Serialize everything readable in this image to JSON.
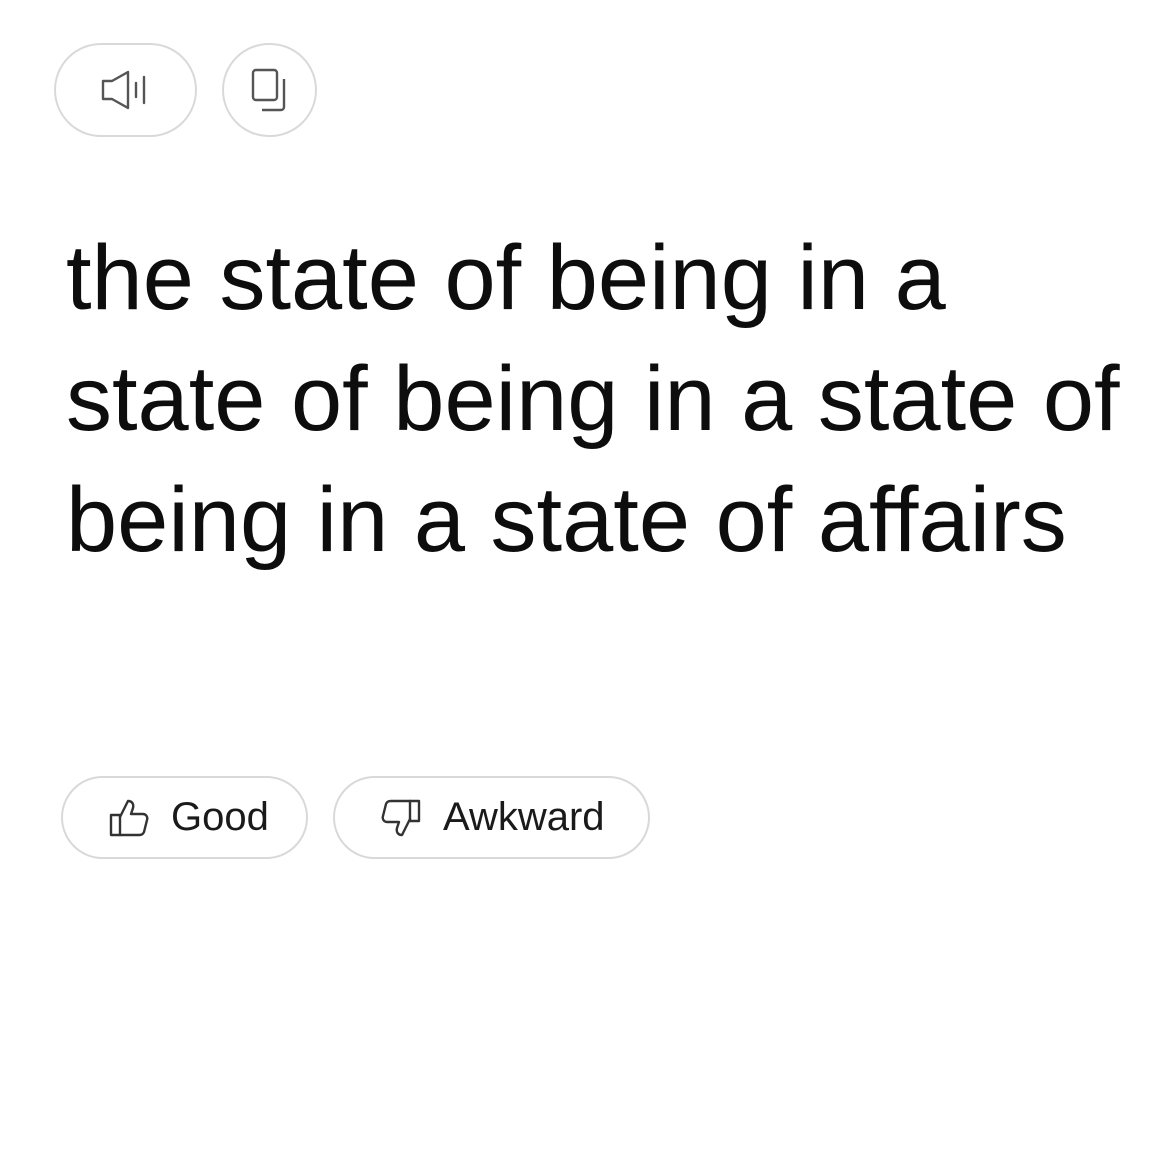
{
  "toolbar": {
    "speak_icon": "speaker-icon",
    "copy_icon": "copy-icon"
  },
  "translation": {
    "text": "the state of being in a state of being in a state of being in a state of affairs"
  },
  "feedback": {
    "good_label": "Good",
    "good_icon": "thumbs-up-icon",
    "awkward_label": "Awkward",
    "awkward_icon": "thumbs-down-icon"
  }
}
